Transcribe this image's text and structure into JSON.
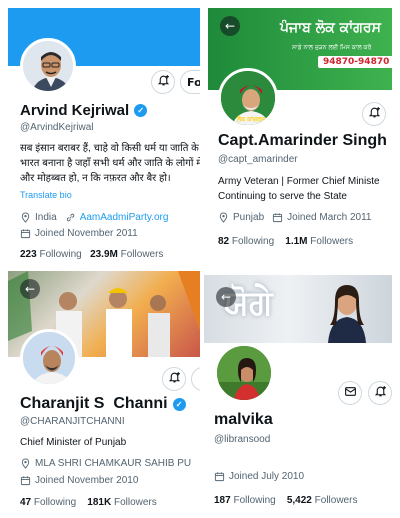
{
  "colors": {
    "verified": "#1d9bf0",
    "link": "#1d9bf0",
    "text_secondary": "#536471"
  },
  "icons": {
    "notify": "bell-plus-icon",
    "message": "envelope-icon",
    "back": "arrow-left-icon",
    "verified": "verified-badge-icon",
    "location": "location-pin-icon",
    "url": "link-icon",
    "joined": "calendar-icon"
  },
  "profiles": [
    {
      "name": "Arvind Kejriwal",
      "handle": "@ArvindKejriwal",
      "bio_lines": [
        "सब इंसान बराबर हैं, चाहे वो किसी धर्म या जाति के।",
        "भारत बनाना है जहाँ सभी धर्म और जाति के लोगों में",
        "और मोहब्बत हो, न कि नफ़रत और बैर हो।"
      ],
      "translate": "Translate bio",
      "location": "India",
      "url": "AamAadmiParty.org",
      "joined": "Joined November 2011",
      "following": "223",
      "following_label": "Following",
      "followers": "23.9M",
      "followers_label": "Followers",
      "follow_button": "Fo"
    },
    {
      "name": "Capt.Amarinder Singh",
      "handle": "@capt_amarinder",
      "banner_title": "ਪੰਜਾਬ ਲੋਕ ਕਾਂਗਰਸ",
      "banner_sub": "ਸਾਡੇ ਨਾਲ ਜੁੜਨ ਲਈ ਮਿਸ ਕਾਲ ਕਰੋ",
      "banner_phone": "94870-94870",
      "avatar_caption": "ਲੋਕ ਕਾਂਗਰਸ",
      "bio_lines": [
        "Army Veteran | Former Chief Ministe",
        "Continuing to serve the State"
      ],
      "location": "Punjab",
      "joined": "Joined March 2011",
      "following": "82",
      "following_label": "Following",
      "followers": "1.1M",
      "followers_label": "Followers"
    },
    {
      "name": "Charanjit S  Channi",
      "handle": "@CHARANJITCHANNI",
      "bio_lines": [
        "Chief Minister of Punjab"
      ],
      "location": "MLA SHRI CHAMKAUR SAHIB PU",
      "joined": "Joined November 2010",
      "following": "47",
      "following_label": "Following",
      "followers": "181K",
      "followers_label": "Followers"
    },
    {
      "name": "malvika",
      "handle": "@libransood",
      "banner_text": "ਯੋਗੇ",
      "joined": "Joined July 2010",
      "following": "187",
      "following_label": "Following",
      "followers": "5,422",
      "followers_label": "Followers"
    }
  ]
}
